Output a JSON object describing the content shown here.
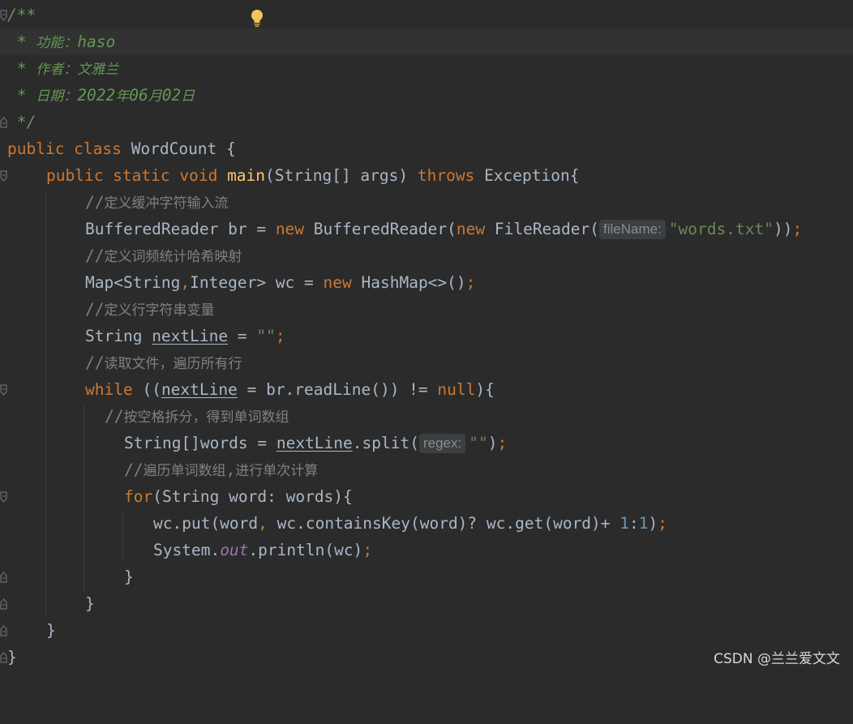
{
  "editor": {
    "language": "Java",
    "colors": {
      "background": "#2b2b2b",
      "current_line": "#323232",
      "keyword": "#cc7832",
      "function": "#ffc66d",
      "string": "#6a8759",
      "number": "#6897bb",
      "doc_comment": "#629755",
      "comment": "#808080",
      "static_field": "#9876aa",
      "text": "#a9b7c6"
    },
    "lines": {
      "l1": {
        "a": "/**"
      },
      "l2": {
        "a": " * ",
        "b": "功能：",
        "c": "haso"
      },
      "l3": {
        "a": " * ",
        "b": "作者：文雅兰"
      },
      "l4": {
        "a": " * ",
        "b": "日期：",
        "c": "2022",
        "d": "年",
        "e": "06",
        "f": "月",
        "g": "02",
        "h": "日"
      },
      "l5": {
        "a": " */"
      },
      "l6": {
        "a": "public class ",
        "b": "WordCount {"
      },
      "l7": {
        "a": "public static void ",
        "b": "main",
        "c": "(String[] args) ",
        "d": "throws ",
        "e": "Exception{"
      },
      "l8": {
        "a": "//",
        "b": "定义缓冲字符输入流"
      },
      "l9": {
        "a": "BufferedReader br = ",
        "b": "new ",
        "c": "BufferedReader(",
        "d": "new ",
        "e": "FileReader(",
        "hint": "fileName:",
        "f": "\"words.txt\"",
        "g": "))",
        "h": ";"
      },
      "l10": {
        "a": "//",
        "b": "定义词频统计哈希映射"
      },
      "l11": {
        "a": "Map<String",
        "b": ",",
        "c": "Integer> wc = ",
        "d": "new ",
        "e": "HashMap<>()",
        "f": ";"
      },
      "l12": {
        "a": "//",
        "b": "定义行字符串变量"
      },
      "l13": {
        "a": "String ",
        "b": "nextLine",
        "c": " = ",
        "d": "\"\"",
        "e": ";"
      },
      "l14": {
        "a": "//",
        "b": "读取文件，遍历所有行"
      },
      "l15": {
        "a": "while ",
        "b": "((",
        "c": "nextLine",
        "d": " = br.readLine()) != ",
        "e": "null",
        "f": "){"
      },
      "l16": {
        "a": "//",
        "b": "按空格拆分，得到单词数组"
      },
      "l17": {
        "a": "String[]words = ",
        "b": "nextLine",
        "c": ".split(",
        "hint": "regex:",
        "d": "\"\"",
        "e": ")",
        "f": ";"
      },
      "l18": {
        "a": "//",
        "b": "遍历单词数组",
        "c": ",",
        "d": "进行单次计算"
      },
      "l19": {
        "a": "for",
        "b": "(String word: words){"
      },
      "l20": {
        "a": "wc.put(word",
        "b": ", ",
        "c": "wc.containsKey(word)? wc.get(word)+ ",
        "d": "1",
        "e": ":",
        "f": "1",
        "g": ")",
        "h": ";"
      },
      "l21": {
        "a": "System.",
        "b": "out",
        "c": ".println(wc)",
        "d": ";"
      },
      "l22": {
        "a": "}"
      },
      "l23": {
        "a": "}"
      },
      "l24": {
        "a": "}"
      },
      "l25": {
        "a": "}"
      }
    }
  },
  "icons": {
    "intention": "lightbulb-icon",
    "fold": "fold-marker-icon"
  },
  "watermark": {
    "text": "CSDN @兰兰爱文文"
  }
}
